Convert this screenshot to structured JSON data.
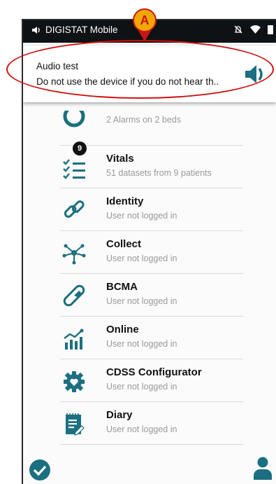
{
  "statusbar": {
    "app_name": "DIGISTAT Mobile"
  },
  "notification": {
    "title": "Audio test",
    "body": "Do not use the device if you do not hear th.."
  },
  "annotation": {
    "marker_label": "A"
  },
  "colors": {
    "accent": "#1b6f80",
    "annotation_red": "#d20f0f",
    "marker_fill": "#f2a700"
  },
  "modules": [
    {
      "title": "",
      "subtitle": "2 Alarms on 2 beds",
      "icon": "alarm-icon"
    },
    {
      "title": "Vitals",
      "subtitle": "51 datasets from 9 patients",
      "icon": "checklist-icon",
      "badge": "9"
    },
    {
      "title": "Identity",
      "subtitle": "User not logged in",
      "icon": "link-icon"
    },
    {
      "title": "Collect",
      "subtitle": "User not logged in",
      "icon": "network-icon"
    },
    {
      "title": "BCMA",
      "subtitle": "User not logged in",
      "icon": "pill-icon"
    },
    {
      "title": "Online",
      "subtitle": "User not logged in",
      "icon": "chart-icon"
    },
    {
      "title": "CDSS Configurator",
      "subtitle": "User not logged in",
      "icon": "gear-heart-icon"
    },
    {
      "title": "Diary",
      "subtitle": "User not logged in",
      "icon": "notepad-icon"
    }
  ],
  "footer": {
    "left_icon": "check-circle-icon",
    "right_icon": "user-icon"
  }
}
